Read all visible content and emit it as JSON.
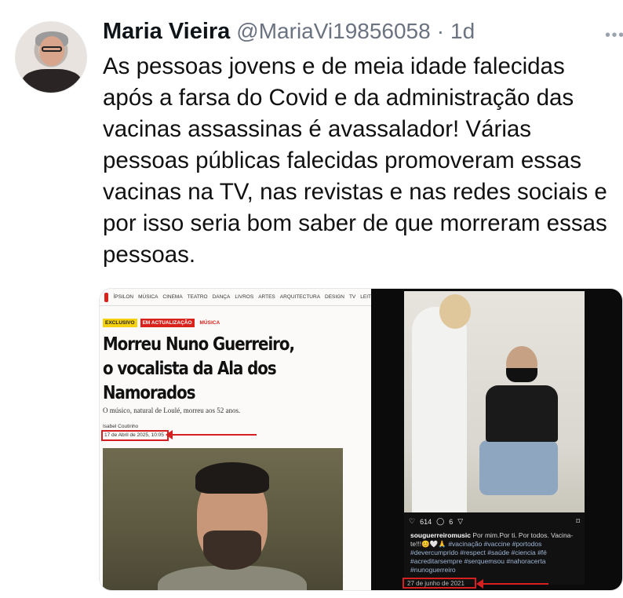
{
  "tweet": {
    "author_name": "Maria Vieira",
    "handle": "@MariaVi19856058",
    "separator": "·",
    "time": "1d",
    "text": "As pessoas jovens e de meia idade falecidas após a farsa do Covid e da administração das vacinas assassinas é avassalador! Várias pessoas públicas falecidas promoveram essas vacinas na TV, nas revistas e nas redes sociais e por isso seria bom saber de que morreram essas pessoas."
  },
  "more_icon": "more-dots-icon",
  "article": {
    "nav_items": [
      "ÍPSILON",
      "MÚSICA",
      "CINEMA",
      "TEATRO",
      "DANÇA",
      "LIVROS",
      "ARTES",
      "ARQUITECTURA",
      "DESIGN",
      "TV",
      "LEIT"
    ],
    "tags": {
      "exclusive": "EXCLUSIVO",
      "updating": "EM ACTUALIZAÇÃO",
      "category": "MÚSICA"
    },
    "headline": "Morreu Nuno Guerreiro, o vocalista da Ala dos Namorados",
    "lede": "O músico, natural de Loulé, morreu aos 52 anos.",
    "author": "Isabel Coutinho",
    "date": "17 de Abril de 2025, 10:05"
  },
  "instagram": {
    "likes": "614",
    "comments": "6",
    "username": "souguerreiromusic",
    "caption": "Por mim.Por ti. Por todos. Vacina-te!!!😊🤍🙏",
    "hashtags": "#vacinação #vaccine #portodos #devercumprido #respect #saúde #ciencia #fé #acreditarsempre #serquemsou #nahoracerta #nunoguerreiro",
    "date": "27 de junho de 2021"
  },
  "colors": {
    "highlight_red": "#d42020",
    "name_text": "#0f1419",
    "meta_gray": "#6b7280"
  }
}
